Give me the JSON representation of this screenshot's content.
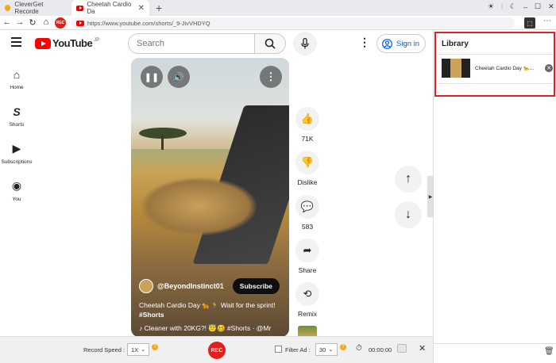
{
  "window": {
    "tabs": [
      {
        "label": "CleverGet Recorde"
      },
      {
        "label": "Cheetah Cardio Da"
      }
    ],
    "rec_badge": "REC",
    "url": "https://www.youtube.com/shorts/_9-JivVHDYQ"
  },
  "youtube": {
    "logo_text": "YouTube",
    "region": "JP",
    "search_placeholder": "Search",
    "sign_in": "Sign in",
    "left_nav": [
      {
        "label": "Home",
        "icon": "home-icon"
      },
      {
        "label": "Shorts",
        "icon": "shorts-icon"
      },
      {
        "label": "Subscriptions",
        "icon": "subscriptions-icon"
      },
      {
        "label": "You",
        "icon": "you-icon"
      }
    ],
    "video": {
      "channel": "@BeyondInstinct01",
      "subscribe": "Subscribe",
      "title": "Cheetah Cardio Day 🐆🏃 Wait for the sprint!",
      "hashtag": "#Shorts",
      "description": "♪ Cleaner with 20KG?! 😇🥴 #Shorts · @Mr"
    },
    "actions": {
      "likes": "71K",
      "dislike": "Dislike",
      "comments": "583",
      "share": "Share",
      "remix": "Remix"
    }
  },
  "library": {
    "title": "Library",
    "items": [
      {
        "title": "Cheetah Cardio Day 🐆..."
      }
    ]
  },
  "record_bar": {
    "speed_label": "Record Speed :",
    "speed_value": "1X",
    "rec": "REC",
    "filter_label": "Filter Ad :",
    "filter_value": "30",
    "timer": "00:00:00"
  },
  "colors": {
    "accent_red": "#e0201b",
    "library_border": "#e02020",
    "sign_in_blue": "#065fd4"
  }
}
